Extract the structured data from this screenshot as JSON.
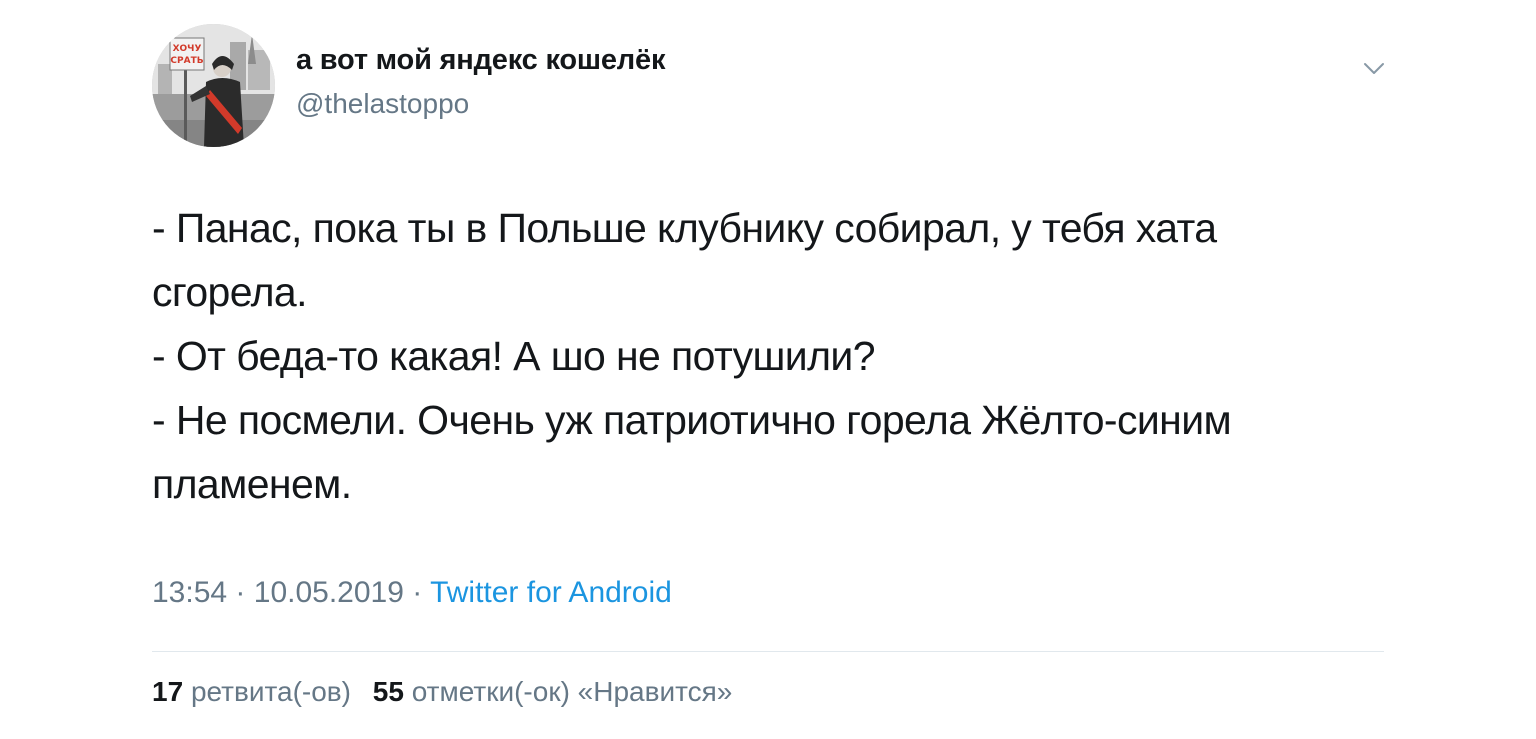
{
  "user": {
    "name": "а вот мой яндекс кошелёк",
    "handle": "@thelastoppo",
    "avatar_sign_text": "ХОЧУ СРАТЬ"
  },
  "tweet": {
    "lines": [
      "- Панас, пока ты в Польше клубнику собирал, у тебя хата",
      "сгорела.",
      "- От беда-то какая! А шо не потушили?",
      "- Не посмели. Очень уж патриотично горела Жёлто-синим",
      "пламенем."
    ],
    "time": "13:54",
    "separator": "·",
    "date": "10.05.2019",
    "source": "Twitter for Android"
  },
  "stats": {
    "retweets_count": "17",
    "retweets_label": "ретвита(-ов)",
    "likes_count": "55",
    "likes_label": "отметки(-ок) «Нравится»"
  },
  "icons": {
    "caret": "chevron-down-icon"
  },
  "colors": {
    "text": "#14171a",
    "secondary": "#657786",
    "link": "#1b95e0",
    "divider": "#e1e8ed"
  }
}
